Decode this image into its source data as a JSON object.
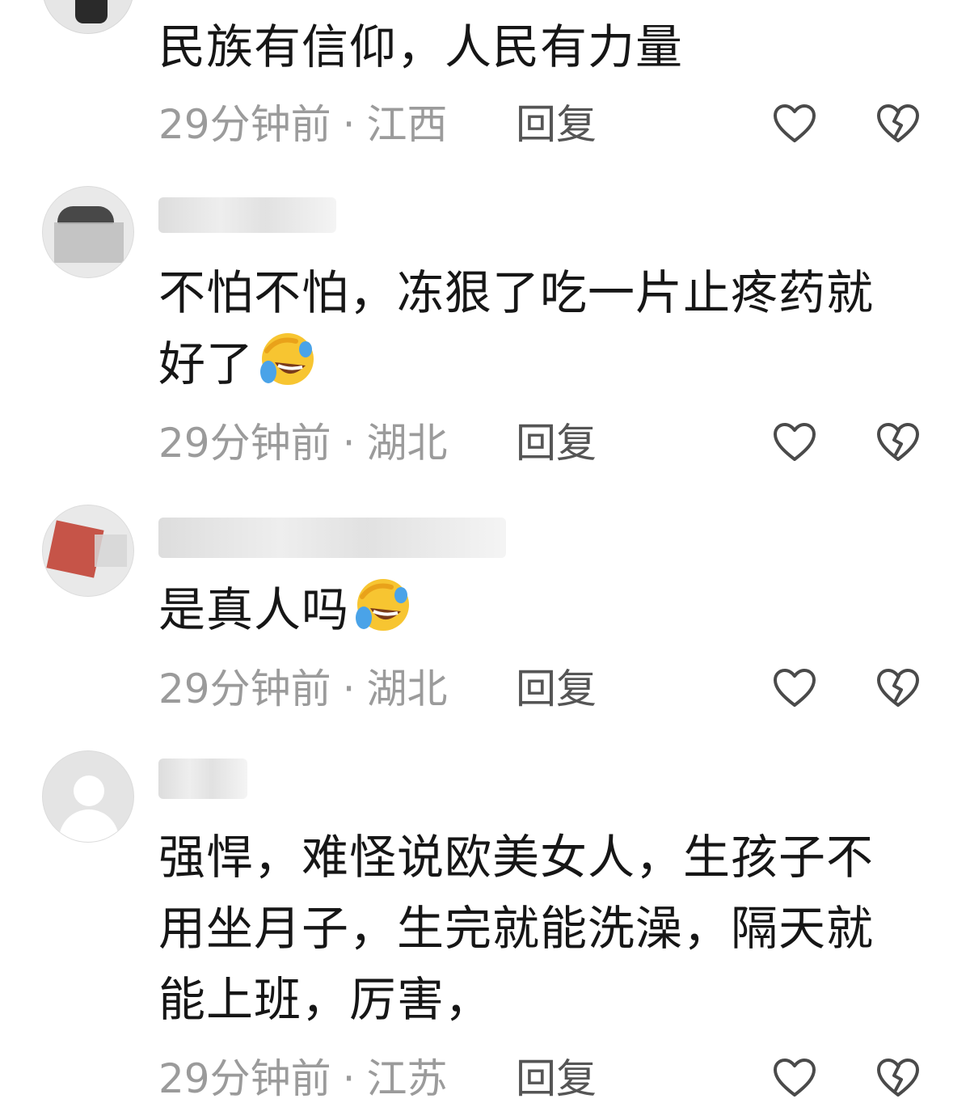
{
  "comments": [
    {
      "text": "民族有信仰，人民有力量",
      "time": "29分钟前",
      "location": "江西",
      "reply_label": "回复",
      "has_emoji": false
    },
    {
      "text_line1": "不怕不怕，冻狠了吃一片止疼药就",
      "text_line2": "好了",
      "time": "29分钟前",
      "location": "湖北",
      "reply_label": "回复",
      "has_emoji": true
    },
    {
      "text": "是真人吗",
      "time": "29分钟前",
      "location": "湖北",
      "reply_label": "回复",
      "has_emoji": true
    },
    {
      "text_line1": "强悍，难怪说欧美女人，生孩子不",
      "text_line2": "用坐月子，生完就能洗澡，隔天就",
      "text_line3": "能上班，厉害，",
      "time": "29分钟前",
      "location": "江苏",
      "reply_label": "回复",
      "has_emoji": false
    }
  ],
  "separator": "·",
  "icons": {
    "like": "heart-outline-icon",
    "dislike": "broken-heart-icon",
    "emoji": "rolling-on-floor-laughing-emoji"
  },
  "colors": {
    "text_primary": "#161616",
    "text_meta": "#9b9b9b",
    "reply": "#555555",
    "icon_stroke": "#4a4a4a",
    "emoji_yellow": "#f7c531",
    "emoji_tear": "#4aa3e8"
  }
}
